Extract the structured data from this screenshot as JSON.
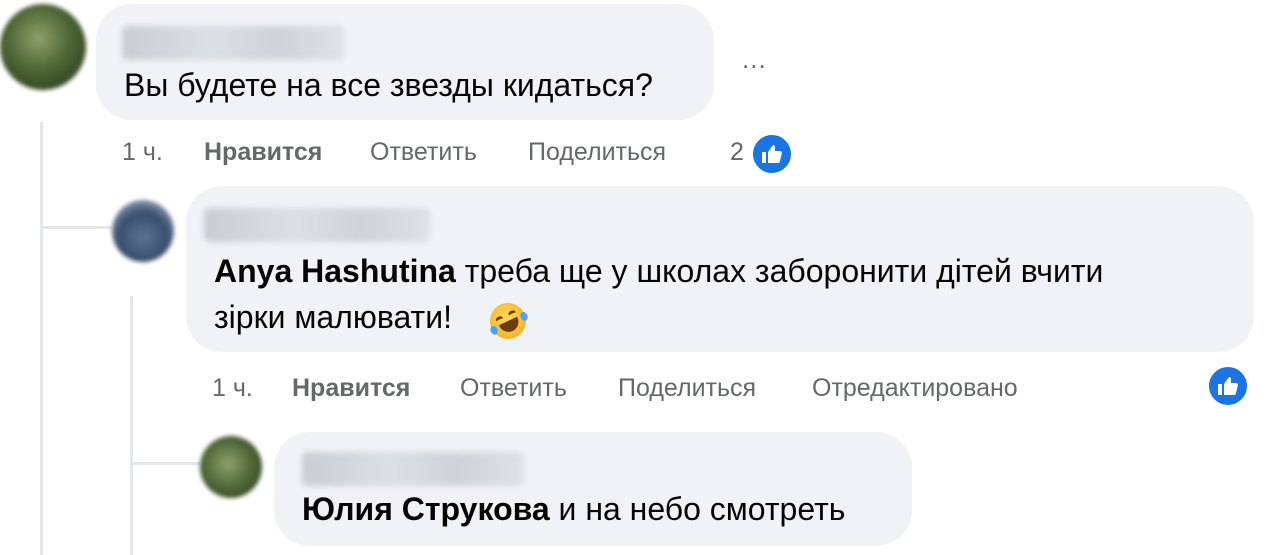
{
  "comments": [
    {
      "text": "Вы будете на все звезды кидаться?",
      "time": "1 ч.",
      "like_label": "Нравится",
      "reply_label": "Ответить",
      "share_label": "Поделиться",
      "reaction_count": "2",
      "more_label": "..."
    },
    {
      "mention": "Anya Hashutina",
      "text_line1": " треба ще у школах заборонити дітей вчити",
      "text_line2": "зірки малювати!",
      "time": "1 ч.",
      "like_label": "Нравится",
      "reply_label": "Ответить",
      "share_label": "Поделиться",
      "edited_label": "Отредактировано"
    },
    {
      "mention": "Юлия Струкова",
      "text": " и на небо смотреть"
    }
  ],
  "icons": {
    "like": "thumbs-up-icon",
    "emoji": "rolling-on-floor-laughing-emoji",
    "more": "more-options-icon"
  },
  "colors": {
    "bubble": "#f0f2f5",
    "secondary_text": "#65676b",
    "like_blue": "#1b74e4"
  }
}
